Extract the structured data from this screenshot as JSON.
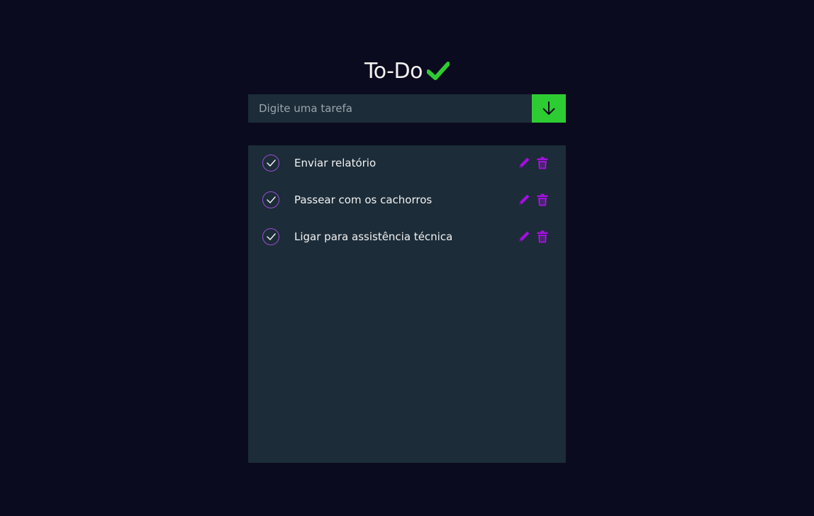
{
  "header": {
    "title": "To-Do",
    "title_icon": "checkmark-icon"
  },
  "input": {
    "placeholder": "Digite uma tarefa",
    "value": "",
    "add_button_icon": "arrow-down-icon"
  },
  "tasks": [
    {
      "text": "Enviar relatório",
      "done_icon": "check-circle-icon",
      "edit_icon": "pencil-icon",
      "delete_icon": "trash-icon"
    },
    {
      "text": "Passear com os cachorros",
      "done_icon": "check-circle-icon",
      "edit_icon": "pencil-icon",
      "delete_icon": "trash-icon"
    },
    {
      "text": "Ligar para assistência técnica",
      "done_icon": "check-circle-icon",
      "edit_icon": "pencil-icon",
      "delete_icon": "trash-icon"
    }
  ],
  "colors": {
    "background": "#0b0b1f",
    "panel": "#1c2c38",
    "accent_green": "#2ecc33",
    "accent_purple": "#a40fe0",
    "circle_border": "#9b4dd6",
    "text": "#f2f2f2"
  }
}
